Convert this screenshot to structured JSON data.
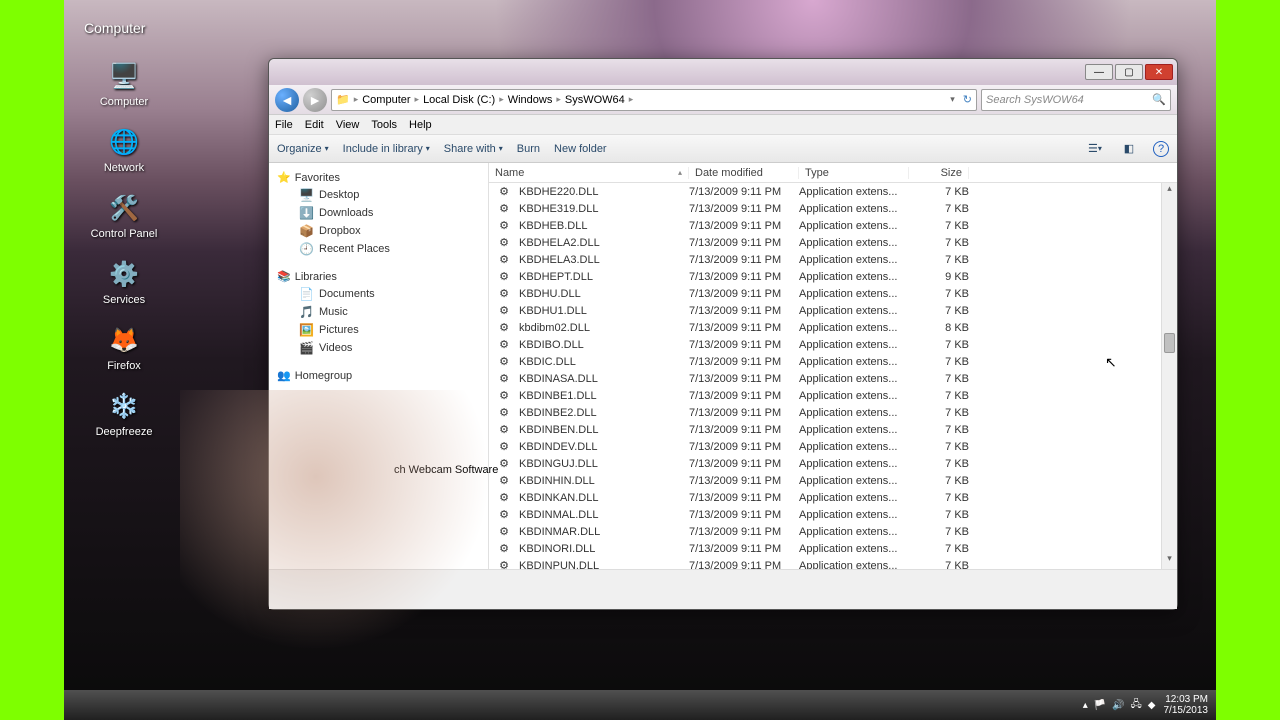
{
  "desktop": {
    "icons": [
      {
        "label": "Computer",
        "glyph": "🖥️"
      },
      {
        "label": "Network",
        "glyph": "🌐"
      },
      {
        "label": "Control Panel",
        "glyph": "🛠️"
      },
      {
        "label": "Services",
        "glyph": "⚙️"
      },
      {
        "label": "Firefox",
        "glyph": "🦊"
      },
      {
        "label": "Deepfreeze",
        "glyph": "❄️"
      }
    ]
  },
  "window": {
    "breadcrumbs": [
      "Computer",
      "Local Disk (C:)",
      "Windows",
      "SysWOW64"
    ],
    "search_placeholder": "Search SysWOW64",
    "menus": [
      "File",
      "Edit",
      "View",
      "Tools",
      "Help"
    ],
    "toolbar": {
      "organize": "Organize",
      "include": "Include in library",
      "share": "Share with",
      "burn": "Burn",
      "newfolder": "New folder"
    },
    "columns": {
      "name": "Name",
      "date": "Date modified",
      "type": "Type",
      "size": "Size"
    },
    "files": [
      {
        "name": "KBDHE220.DLL",
        "date": "7/13/2009 9:11 PM",
        "type": "Application extens...",
        "size": "7 KB"
      },
      {
        "name": "KBDHE319.DLL",
        "date": "7/13/2009 9:11 PM",
        "type": "Application extens...",
        "size": "7 KB"
      },
      {
        "name": "KBDHEB.DLL",
        "date": "7/13/2009 9:11 PM",
        "type": "Application extens...",
        "size": "7 KB"
      },
      {
        "name": "KBDHELA2.DLL",
        "date": "7/13/2009 9:11 PM",
        "type": "Application extens...",
        "size": "7 KB"
      },
      {
        "name": "KBDHELA3.DLL",
        "date": "7/13/2009 9:11 PM",
        "type": "Application extens...",
        "size": "7 KB"
      },
      {
        "name": "KBDHEPT.DLL",
        "date": "7/13/2009 9:11 PM",
        "type": "Application extens...",
        "size": "9 KB"
      },
      {
        "name": "KBDHU.DLL",
        "date": "7/13/2009 9:11 PM",
        "type": "Application extens...",
        "size": "7 KB"
      },
      {
        "name": "KBDHU1.DLL",
        "date": "7/13/2009 9:11 PM",
        "type": "Application extens...",
        "size": "7 KB"
      },
      {
        "name": "kbdibm02.DLL",
        "date": "7/13/2009 9:11 PM",
        "type": "Application extens...",
        "size": "8 KB"
      },
      {
        "name": "KBDIBO.DLL",
        "date": "7/13/2009 9:11 PM",
        "type": "Application extens...",
        "size": "7 KB"
      },
      {
        "name": "KBDIC.DLL",
        "date": "7/13/2009 9:11 PM",
        "type": "Application extens...",
        "size": "7 KB"
      },
      {
        "name": "KBDINASA.DLL",
        "date": "7/13/2009 9:11 PM",
        "type": "Application extens...",
        "size": "7 KB"
      },
      {
        "name": "KBDINBE1.DLL",
        "date": "7/13/2009 9:11 PM",
        "type": "Application extens...",
        "size": "7 KB"
      },
      {
        "name": "KBDINBE2.DLL",
        "date": "7/13/2009 9:11 PM",
        "type": "Application extens...",
        "size": "7 KB"
      },
      {
        "name": "KBDINBEN.DLL",
        "date": "7/13/2009 9:11 PM",
        "type": "Application extens...",
        "size": "7 KB"
      },
      {
        "name": "KBDINDEV.DLL",
        "date": "7/13/2009 9:11 PM",
        "type": "Application extens...",
        "size": "7 KB"
      },
      {
        "name": "KBDINGUJ.DLL",
        "date": "7/13/2009 9:11 PM",
        "type": "Application extens...",
        "size": "7 KB"
      },
      {
        "name": "KBDINHIN.DLL",
        "date": "7/13/2009 9:11 PM",
        "type": "Application extens...",
        "size": "7 KB"
      },
      {
        "name": "KBDINKAN.DLL",
        "date": "7/13/2009 9:11 PM",
        "type": "Application extens...",
        "size": "7 KB"
      },
      {
        "name": "KBDINMAL.DLL",
        "date": "7/13/2009 9:11 PM",
        "type": "Application extens...",
        "size": "7 KB"
      },
      {
        "name": "KBDINMAR.DLL",
        "date": "7/13/2009 9:11 PM",
        "type": "Application extens...",
        "size": "7 KB"
      },
      {
        "name": "KBDINORI.DLL",
        "date": "7/13/2009 9:11 PM",
        "type": "Application extens...",
        "size": "7 KB"
      },
      {
        "name": "KBDINPUN.DLL",
        "date": "7/13/2009 9:11 PM",
        "type": "Application extens...",
        "size": "7 KB"
      }
    ],
    "sidebar": {
      "favorites": {
        "label": "Favorites",
        "items": [
          "Desktop",
          "Downloads",
          "Dropbox",
          "Recent Places"
        ]
      },
      "libraries": {
        "label": "Libraries",
        "items": [
          "Documents",
          "Music",
          "Pictures",
          "Videos"
        ]
      },
      "homegroup": {
        "label": "Homegroup"
      }
    }
  },
  "taskbar": {
    "time": "12:03 PM",
    "date": "7/15/2013"
  },
  "labels": {
    "webcam": "ch Webcam Software",
    "computer_header": "Computer"
  }
}
